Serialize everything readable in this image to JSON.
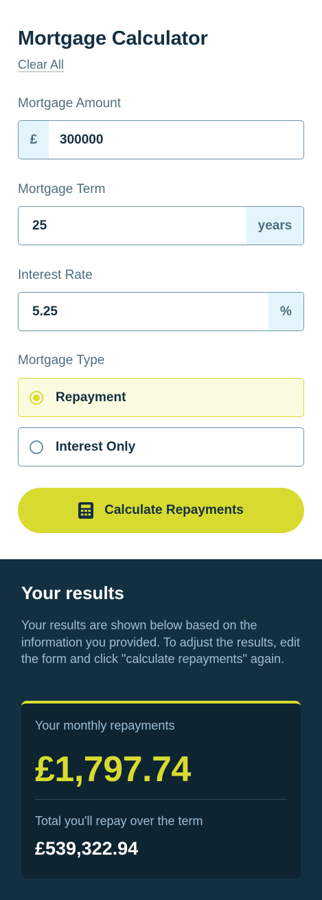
{
  "header": {
    "title": "Mortgage Calculator",
    "clear_all": "Clear All"
  },
  "fields": {
    "amount": {
      "label": "Mortgage Amount",
      "prefix": "£",
      "value": "300000"
    },
    "term": {
      "label": "Mortgage Term",
      "suffix": "years",
      "value": "25"
    },
    "rate": {
      "label": "Interest Rate",
      "suffix": "%",
      "value": "5.25"
    }
  },
  "mortgage_type": {
    "label": "Mortgage Type",
    "options": [
      {
        "label": "Repayment",
        "selected": true
      },
      {
        "label": "Interest Only",
        "selected": false
      }
    ]
  },
  "calculate_button": {
    "label": "Calculate Repayments",
    "icon": "calculator-icon"
  },
  "results": {
    "title": "Your results",
    "description": "Your results are shown below based on the information you provided. To adjust the results, edit the form and click \"calculate repayments\" again.",
    "monthly_label": "Your monthly repayments",
    "monthly_value": "£1,797.74",
    "total_label": "Total you'll repay over the term",
    "total_value": "£539,322.94"
  },
  "colors": {
    "accent_lime": "#d8db2f",
    "navy": "#133041",
    "slate": "#4e6e7e",
    "light_blue": "#e3f4fc"
  }
}
